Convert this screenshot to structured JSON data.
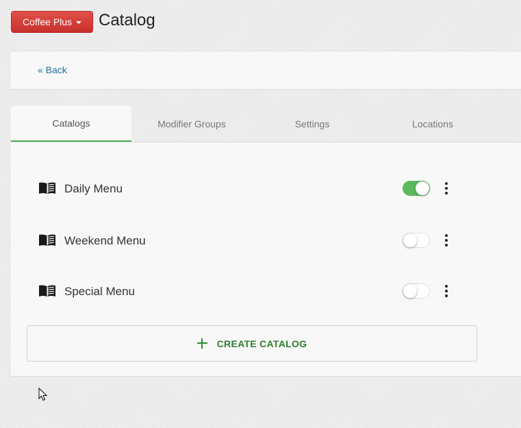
{
  "header": {
    "brand_label": "Coffee Plus",
    "title": "Catalog"
  },
  "nav": {
    "back_label": "« Back"
  },
  "tabs": [
    {
      "label": "Catalogs",
      "active": true
    },
    {
      "label": "Modifier Groups",
      "active": false
    },
    {
      "label": "Settings",
      "active": false
    },
    {
      "label": "Locations",
      "active": false
    }
  ],
  "catalogs": [
    {
      "name": "Daily Menu",
      "enabled": true,
      "icon": "book-icon"
    },
    {
      "name": "Weekend Menu",
      "enabled": false,
      "icon": "book-icon"
    },
    {
      "name": "Special Menu",
      "enabled": false,
      "icon": "book-icon"
    }
  ],
  "create_button": {
    "label": "CREATE CATALOG",
    "icon": "plus-icon"
  },
  "colors": {
    "brand": "#d9403a",
    "accent_green": "#4caf50",
    "toggle_on": "#5cb85c",
    "link": "#1f6e9c",
    "create_text": "#2e7d2e"
  }
}
